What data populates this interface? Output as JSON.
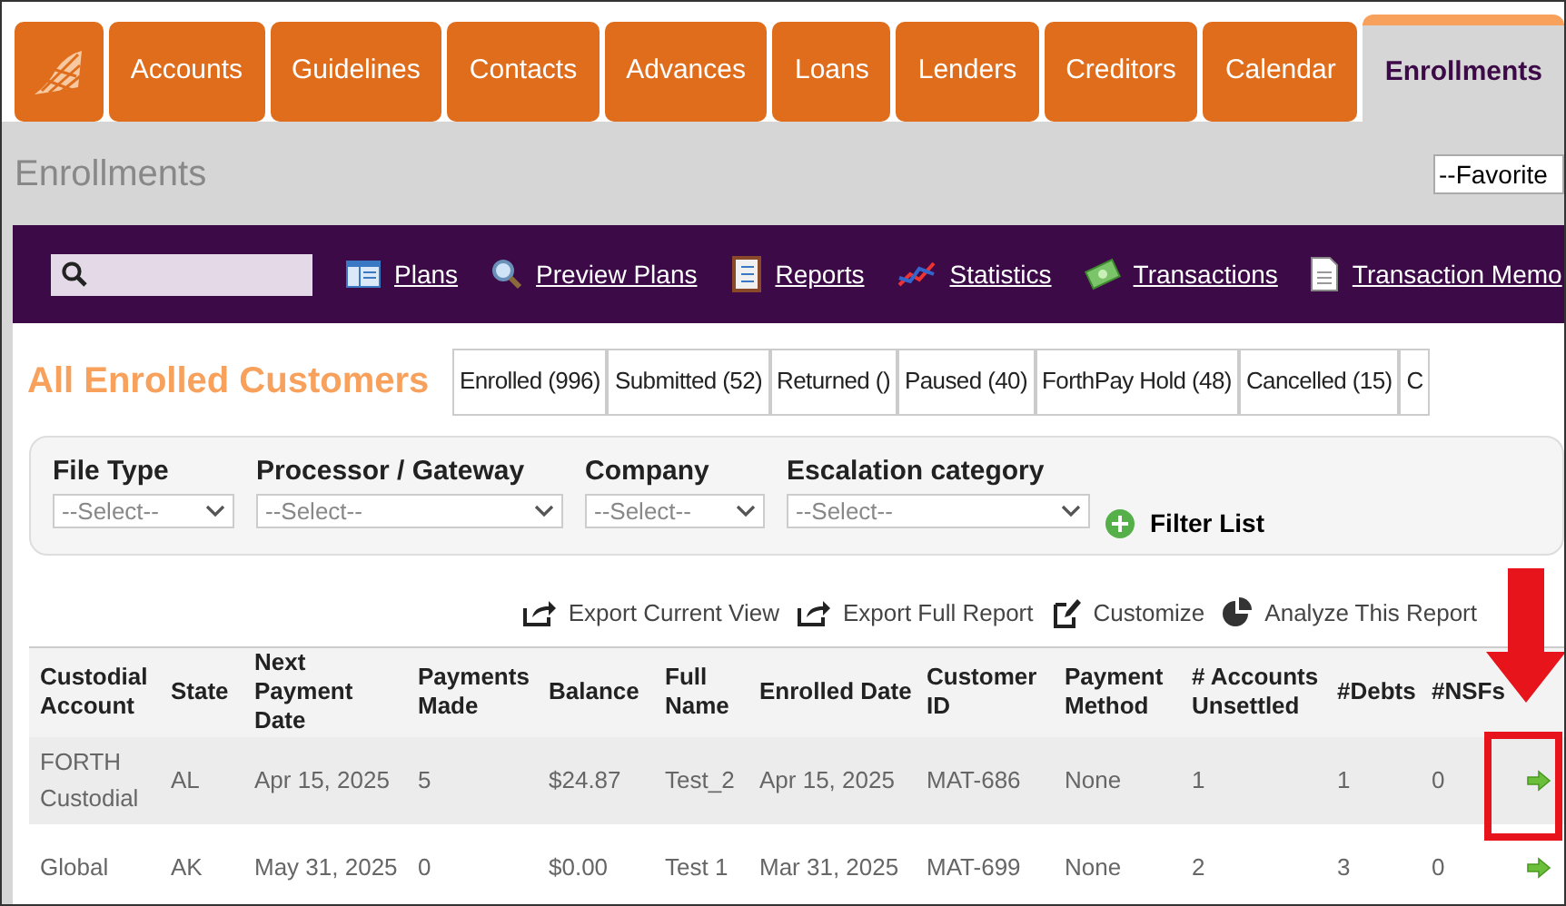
{
  "nav_tabs": [
    {
      "label": "Accounts",
      "selected": false
    },
    {
      "label": "Guidelines",
      "selected": false
    },
    {
      "label": "Contacts",
      "selected": false
    },
    {
      "label": "Advances",
      "selected": false
    },
    {
      "label": "Loans",
      "selected": false
    },
    {
      "label": "Lenders",
      "selected": false
    },
    {
      "label": "Creditors",
      "selected": false
    },
    {
      "label": "Calendar",
      "selected": false
    },
    {
      "label": "Enrollments",
      "selected": true
    }
  ],
  "page_title": "Enrollments",
  "favorites_select": "--Favorite",
  "toolbar_links": [
    {
      "label": "Plans",
      "kind": "plans"
    },
    {
      "label": "Preview Plans",
      "kind": "preview"
    },
    {
      "label": "Reports",
      "kind": "reports"
    },
    {
      "label": "Statistics",
      "kind": "statistics"
    },
    {
      "label": "Transactions",
      "kind": "transactions"
    },
    {
      "label": "Transaction Memo",
      "kind": "memo"
    }
  ],
  "section_title": "All Enrolled Customers",
  "status_tabs": [
    {
      "label": "Enrolled (996)",
      "selected": false
    },
    {
      "label": "Submitted (52)",
      "selected": false
    },
    {
      "label": "Returned ()",
      "selected": false
    },
    {
      "label": "Paused (40)",
      "selected": false
    },
    {
      "label": "ForthPay Hold (48)",
      "selected": false
    },
    {
      "label": "Cancelled (15)",
      "selected": false
    },
    {
      "label": "C",
      "selected": false
    }
  ],
  "filters": [
    {
      "label": "File Type",
      "value": "--Select--"
    },
    {
      "label": "Processor / Gateway",
      "value": "--Select--"
    },
    {
      "label": "Company",
      "value": "--Select--"
    },
    {
      "label": "Escalation category",
      "value": "--Select--"
    }
  ],
  "filter_button": "Filter List",
  "actions": [
    {
      "label": "Export Current View",
      "kind": "export"
    },
    {
      "label": "Export Full Report",
      "kind": "export"
    },
    {
      "label": "Customize",
      "kind": "customize"
    },
    {
      "label": "Analyze This Report",
      "kind": "analyze"
    }
  ],
  "table": {
    "columns": [
      "Custodial Account",
      "State",
      "Next Payment Date",
      "Payments Made",
      "Balance",
      "Full Name",
      "Enrolled Date",
      "Customer ID",
      "Payment Method",
      "# Accounts Unsettled",
      "#Debts",
      "#NSFs"
    ],
    "rows": [
      {
        "cells": [
          "FORTH Custodial",
          "AL",
          "Apr 15, 2025",
          "5",
          "$24.87",
          "Test_2",
          "Apr 15, 2025",
          "MAT-686",
          "None",
          "1",
          "1",
          "0"
        ],
        "highlighted": true
      },
      {
        "cells": [
          "Global",
          "AK",
          "May 31, 2025",
          "0",
          "$0.00",
          "Test 1",
          "Mar 31, 2025",
          "MAT-699",
          "None",
          "2",
          "3",
          "0"
        ],
        "highlighted": false
      }
    ]
  }
}
